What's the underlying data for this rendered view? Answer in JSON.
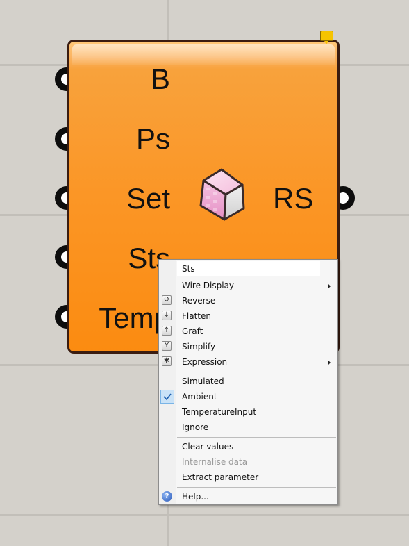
{
  "component": {
    "inputs": [
      "B",
      "Ps",
      "Set",
      "Sts",
      "Temp"
    ],
    "output": "RS",
    "icon": "building-block-icon"
  },
  "context_menu": {
    "header": "Sts",
    "items": [
      {
        "label": "Wire Display",
        "submenu": true
      },
      {
        "label": "Reverse",
        "icon": "reverse-icon"
      },
      {
        "label": "Flatten",
        "icon": "flatten-icon"
      },
      {
        "label": "Graft",
        "icon": "graft-icon"
      },
      {
        "label": "Simplify",
        "icon": "simplify-icon"
      },
      {
        "label": "Expression",
        "icon": "expression-icon",
        "submenu": true
      },
      {
        "label": "Simulated"
      },
      {
        "label": "Ambient",
        "checked": true
      },
      {
        "label": "TemperatureInput"
      },
      {
        "label": "Ignore"
      },
      {
        "label": "Clear values"
      },
      {
        "label": "Internalise data",
        "disabled": true
      },
      {
        "label": "Extract parameter"
      },
      {
        "label": "Help...",
        "icon": "help-icon"
      }
    ]
  },
  "colors": {
    "canvas": "#d4d1cb",
    "component_fill": "#fb9626",
    "component_border": "#3a1c10",
    "menu_checked": "#c9e2f7"
  }
}
